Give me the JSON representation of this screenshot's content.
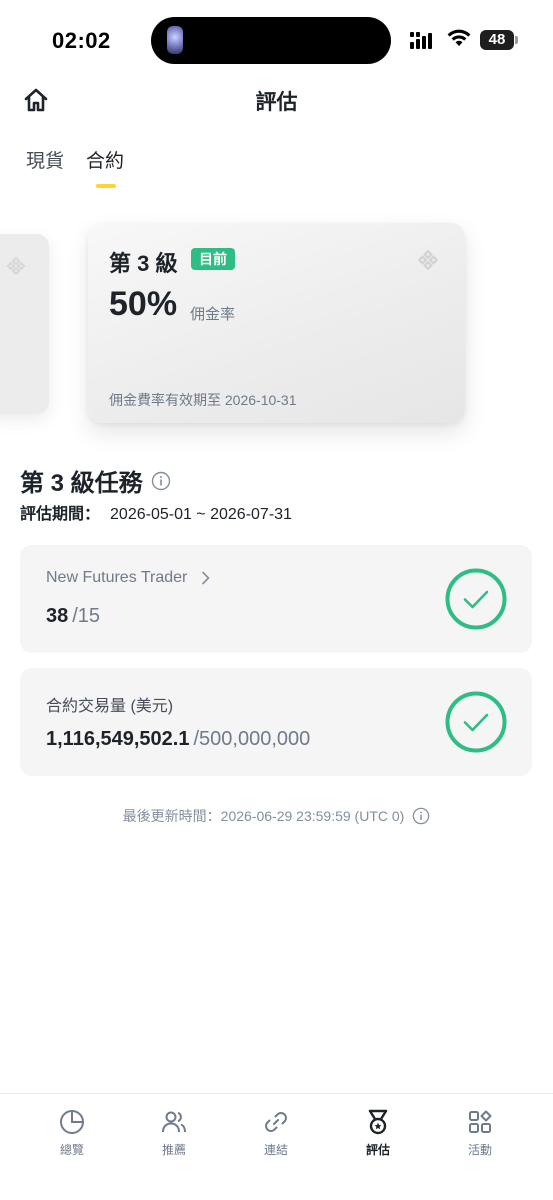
{
  "status_bar": {
    "time": "02:02",
    "battery": "48"
  },
  "header": {
    "title": "評估",
    "home_icon": "home-icon"
  },
  "tabs": [
    {
      "label": "現貨",
      "active": false
    },
    {
      "label": "合約",
      "active": true
    }
  ],
  "tier_card": {
    "level": "第 3 級",
    "badge": "目前",
    "rate": "50%",
    "rate_label": "佣金率",
    "valid_until": "佣金費率有效期至 2026-10-31"
  },
  "section": {
    "title": "第 3 級任務",
    "period_label": "評估期間：",
    "period_value": "2026-05-01 ~ 2026-07-31"
  },
  "tasks": [
    {
      "name": "New Futures Trader",
      "current": "38",
      "target": "/15",
      "completed": true
    },
    {
      "name": "合約交易量 (美元)",
      "current": "1,116,549,502.1",
      "target": "/500,000,000",
      "completed": true
    }
  ],
  "last_update": "最後更新時間：2026-06-29 23:59:59 (UTC 0)",
  "bottom_nav": [
    {
      "label": "總覽",
      "icon": "pie-chart-icon",
      "active": false
    },
    {
      "label": "推薦",
      "icon": "users-icon",
      "active": false
    },
    {
      "label": "連結",
      "icon": "link-icon",
      "active": false
    },
    {
      "label": "評估",
      "icon": "medal-icon",
      "active": true
    },
    {
      "label": "活動",
      "icon": "grid-icon",
      "active": false
    }
  ],
  "colors": {
    "accent_yellow": "#fcd535",
    "success_green": "#2ebd85",
    "text_primary": "#1e2329",
    "text_secondary": "#707a8a"
  }
}
